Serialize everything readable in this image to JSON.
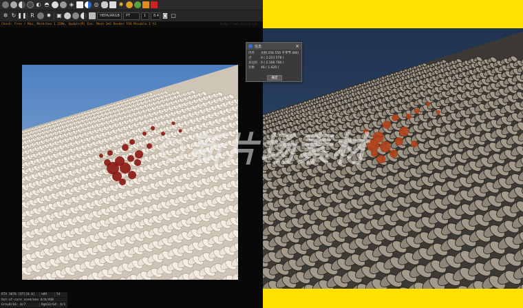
{
  "toolbar": {
    "icons_row1": [
      "sphere-shaded-icon",
      "sphere-grey-icon",
      "sphere-half-icon",
      "sphere-dark-icon",
      "lamp-icon",
      "environment-icon",
      "sphere-white-icon",
      "sphere-grey2-icon",
      "cube-icon",
      "cube-white-icon",
      "half-circle-icon",
      "target-icon",
      "pill-icon",
      "box-icon",
      "light-bulb-icon",
      "sun-icon",
      "color-ball-icon",
      "package-icon",
      "record-icon"
    ],
    "icons_row2": [
      "gear-icon",
      "refresh-icon",
      "pause-icon",
      "region-icon",
      "reset-icon",
      "settings-icon",
      "lock-icon",
      "sphere-icon",
      "sphere2-icon",
      "half-sphere-icon",
      "box2-icon",
      "camera-icon",
      "snapshot-icon"
    ],
    "kernel_dropdown": "HEPA/ARGB",
    "mode_dropdown": "PT",
    "pass_value": "1",
    "zoom_value": "8.4"
  },
  "status_line": "Check: Free / Max, Mesh/Gen 1 25Mm, Update(M) Ens: Mesh 1%5 Render FXX Movable 3 t3",
  "status_right": "Hidp://www.xiniu.com",
  "stats": {
    "gpu": "RTX 3070 [DT][8.6]",
    "gpu_pct": "%89",
    "gpu_temp": "54",
    "memory": "Out-of-core used/max 0/0/4GB",
    "grey": "Grey8/16: 0/7",
    "rgb": "Rgb32/64: 4/1"
  },
  "dialog": {
    "title": "信息",
    "rows": [
      {
        "label": "内存",
        "value": "大约 256.550 千字节 (KB)"
      },
      {
        "label": "点",
        "value": "0 ( 2.223 578 )"
      },
      {
        "label": "多边形",
        "value": "0 ( 2.166 700 )"
      },
      {
        "label": "对象",
        "value": "46 ( 1.620 )"
      }
    ],
    "ok_label": "确定"
  },
  "watermark": {
    "text": "新片场素材"
  },
  "colors": {
    "side_yellow": "#ffe100",
    "status_orange": "#c8822c",
    "yarn": "#ece4d8",
    "blood": "#8a1612",
    "sky": "#6f96c6"
  }
}
